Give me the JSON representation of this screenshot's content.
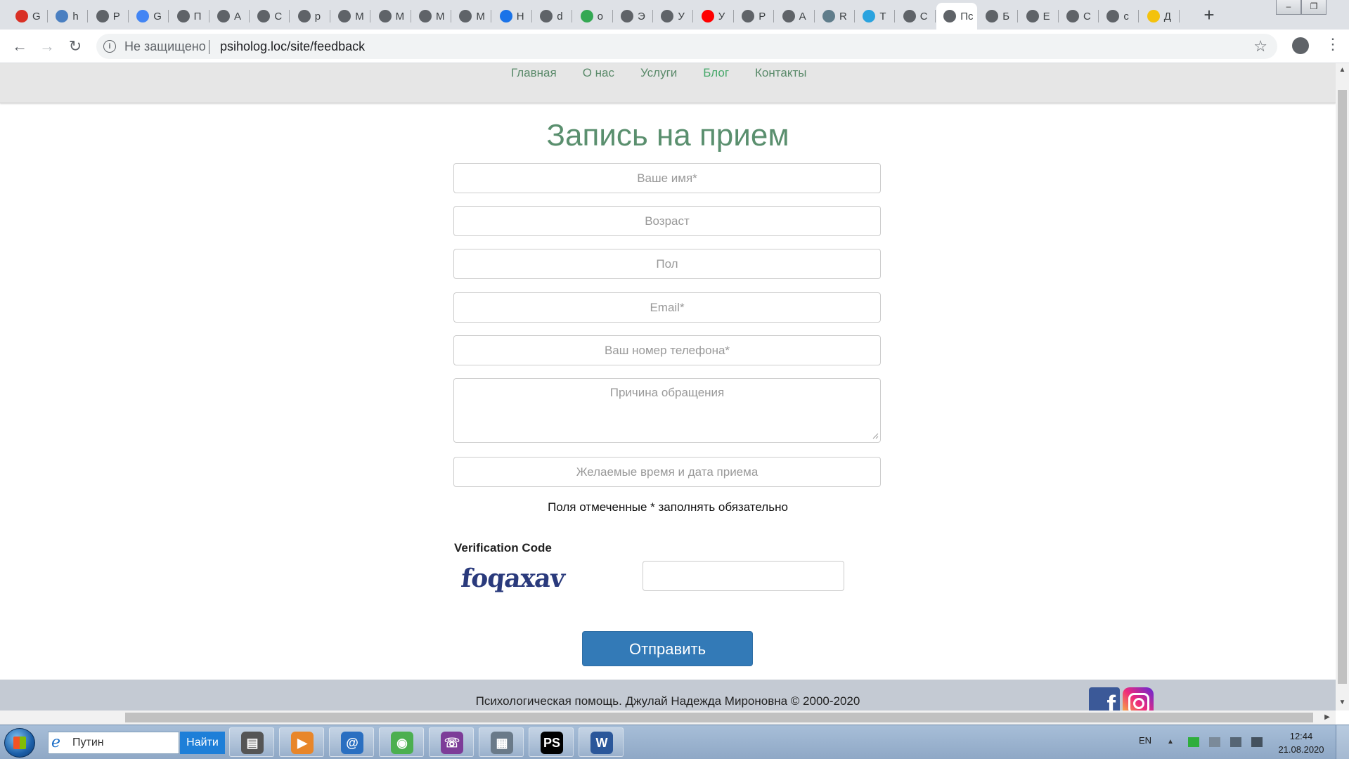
{
  "browser": {
    "tabs": [
      {
        "letter": "G",
        "icon": "gmail-icon",
        "color": "#d93025"
      },
      {
        "letter": "h",
        "icon": "shield-icon",
        "color": "#4a7fc1"
      },
      {
        "letter": "P",
        "icon": "globe-icon",
        "color": "#5f6368"
      },
      {
        "letter": "G",
        "icon": "translate-icon",
        "color": "#4285f4"
      },
      {
        "letter": "П",
        "icon": "globe-icon",
        "color": "#5f6368"
      },
      {
        "letter": "A",
        "icon": "globe-icon",
        "color": "#5f6368"
      },
      {
        "letter": "C",
        "icon": "globe-icon",
        "color": "#5f6368"
      },
      {
        "letter": "p",
        "icon": "globe-icon",
        "color": "#5f6368"
      },
      {
        "letter": "M",
        "icon": "globe-icon",
        "color": "#5f6368"
      },
      {
        "letter": "M",
        "icon": "globe-icon",
        "color": "#5f6368"
      },
      {
        "letter": "M",
        "icon": "globe-icon",
        "color": "#5f6368"
      },
      {
        "letter": "M",
        "icon": "globe-icon",
        "color": "#5f6368"
      },
      {
        "letter": "H",
        "icon": "gear-icon",
        "color": "#1a73e8"
      },
      {
        "letter": "d",
        "icon": "globe-icon",
        "color": "#5f6368"
      },
      {
        "letter": "o",
        "icon": "maps-pin-icon",
        "color": "#34a853"
      },
      {
        "letter": "Э",
        "icon": "globe-icon",
        "color": "#5f6368"
      },
      {
        "letter": "У",
        "icon": "globe-icon",
        "color": "#5f6368"
      },
      {
        "letter": "У",
        "icon": "youtube-icon",
        "color": "#ff0000"
      },
      {
        "letter": "P",
        "icon": "globe-icon",
        "color": "#5f6368"
      },
      {
        "letter": "A",
        "icon": "globe-icon",
        "color": "#5f6368"
      },
      {
        "letter": "R",
        "icon": "doc-icon",
        "color": "#607d8b"
      },
      {
        "letter": "T",
        "icon": "telegram-icon",
        "color": "#2aa3df"
      },
      {
        "letter": "C",
        "icon": "globe-icon",
        "color": "#5f6368"
      },
      {
        "letter": "Пс",
        "icon": "globe-icon",
        "color": "#5f6368",
        "active": true
      },
      {
        "letter": "Б",
        "icon": "globe-icon",
        "color": "#5f6368"
      },
      {
        "letter": "E",
        "icon": "globe-icon",
        "color": "#5f6368"
      },
      {
        "letter": "C",
        "icon": "globe-icon",
        "color": "#5f6368"
      },
      {
        "letter": "c",
        "icon": "globe-icon",
        "color": "#5f6368"
      },
      {
        "letter": "Д",
        "icon": "pencil-icon",
        "color": "#f4c20d"
      }
    ],
    "new_tab": "+",
    "address": {
      "security": "Не защищено",
      "url": "psiholog.loc/site/feedback"
    }
  },
  "site": {
    "nav": [
      "Главная",
      "О нас",
      "Услуги",
      "Блог",
      "Контакты"
    ],
    "nav_active": "Блог",
    "title": "Запись на прием",
    "fields": {
      "name": "Ваше имя*",
      "age": "Возраст",
      "gender": "Пол",
      "email": "Email*",
      "phone": "Ваш номер телефона*",
      "reason": "Причина обращения",
      "datetime": "Желаемые время и дата приема"
    },
    "required_note": "Поля отмеченные * заполнять обязательно",
    "verification_label": "Verification Code",
    "captcha_text": "foqaxav",
    "submit": "Отправить",
    "footer": "Психологическая помощь. Джулай Надежда Мироновна © 2000-2020",
    "social": [
      "facebook-icon",
      "instagram-icon"
    ]
  },
  "taskbar": {
    "search_value": "Путин",
    "search_button": "Найти",
    "apps": [
      "file-manager-icon",
      "media-player-icon",
      "mail-at-icon",
      "chrome-icon",
      "viber-icon",
      "calculator-icon",
      "phpstorm-icon",
      "word-icon"
    ],
    "lang": "EN",
    "time": "12:44",
    "date": "21.08.2020"
  },
  "colors": {
    "accent_green": "#5a8f6e",
    "nav_active": "#47a86a",
    "submit_blue": "#337ab7",
    "footer_bg": "#c4cad3"
  }
}
